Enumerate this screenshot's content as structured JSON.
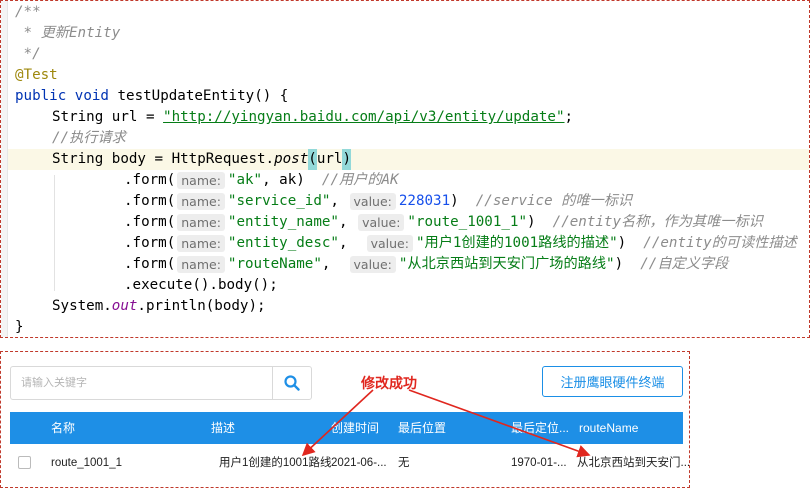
{
  "code": {
    "comment_open": "/**",
    "comment_body": " * 更新Entity",
    "comment_close": " */",
    "annotation": "@Test",
    "kw_public": "public",
    "kw_void": "void",
    "method_name": "testUpdateEntity",
    "method_parens": "() {",
    "var_url_decl": "String url = ",
    "url_value": "\"http://yingyan.baidu.com/api/v3/entity/update\"",
    "semicolon": ";",
    "comment_exec": "//执行请求",
    "body_decl": "String body = HttpRequest.",
    "post_call": "post",
    "paren_open": "(",
    "url_arg": "url",
    "paren_close": ")",
    "form_call": ".form(",
    "hint_name": "name:",
    "hint_value": "value:",
    "form1_name": "\"ak\"",
    "form1_value": " ak",
    "form1_comment": "//用户的AK",
    "form2_name": "\"service_id\"",
    "form2_value": "228031",
    "form2_comment": "//service 的唯一标识",
    "form3_name": "\"entity_name\"",
    "form3_value": "\"route_1001_1\"",
    "form3_comment": "//entity名称，作为其唯一标识",
    "form4_name": "\"entity_desc\"",
    "form4_value": "\"用户1创建的1001路线的描述\"",
    "form4_comment": "//entity的可读性描述",
    "form5_name": "\"routeName\"",
    "form5_value": "\"从北京西站到天安门广场的路线\"",
    "form5_comment": "//自定义字段",
    "comma": ",",
    "close_paren": ")",
    "execute_line": ".execute().body();",
    "println_prefix": "System.",
    "println_out": "out",
    "println_suffix": ".println(body);",
    "closing_brace": "}"
  },
  "ui": {
    "search": {
      "placeholder": "请输入关键字",
      "icon": "search-icon"
    },
    "register_button": "注册鹰眼硬件终端",
    "annotation": "修改成功",
    "table": {
      "headers": [
        "名称",
        "描述",
        "创建时间",
        "最后位置",
        "最后定位...",
        "routeName"
      ],
      "row": [
        "route_1001_1",
        "用户1创建的1001路线",
        "2021-06-...",
        "无",
        "1970-01-...",
        "从北京西站到天安门..."
      ]
    },
    "colors": {
      "primary": "#1e8fe6",
      "annotation_red": "#e0271f",
      "border_red": "#c0392b"
    }
  }
}
